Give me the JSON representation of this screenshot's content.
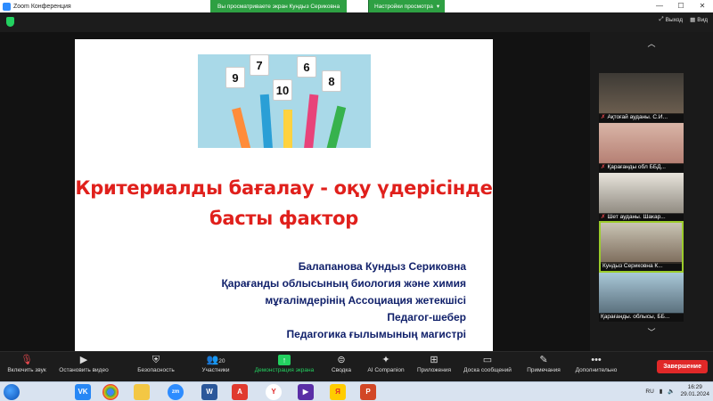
{
  "titlebar": {
    "app_title": "Zoom Конференция",
    "share_banner": "Вы просматриваете экран Кундыз Сериковна",
    "view_options": "Настройки просмотра",
    "view_options_caret": "▾"
  },
  "topbar": {
    "exit_label": "Выход",
    "view_label": "Вид"
  },
  "slide": {
    "cards": [
      "9",
      "7",
      "10",
      "6",
      "8"
    ],
    "title_line1": "Критериалды бағалау - оқу үдерісінде",
    "title_line2": "басты фактор",
    "author_lines": [
      "Балапанова Кундыз Сериковна",
      "Қарағанды облысының биология және химия",
      "мұғалімдерінің Ассоциация жетекшісі",
      "Педагог-шебер",
      "Педагогика ғылымының магистрі"
    ]
  },
  "gallery": {
    "up_chevron": "︿",
    "down_chevron": "﹀",
    "tiles": [
      {
        "name": "Ақтоғай ауданы. С.И...",
        "muted": true
      },
      {
        "name": "Қарағанды обл ББД...",
        "muted": true
      },
      {
        "name": "Шет ауданы. Шакар...",
        "muted": true
      },
      {
        "name": "Кундыз Сериковна К...",
        "muted": false
      },
      {
        "name": "Қарағанды. облысы, ББ...",
        "muted": false
      }
    ]
  },
  "toolbar": {
    "mute": "Включить звук",
    "video": "Остановить видео",
    "security": "Безопасность",
    "participants": "Участники",
    "participants_count": "20",
    "share": "Демонстрация экрана",
    "summary": "Сводка",
    "ai": "AI Companion",
    "apps": "Приложения",
    "chat": "Доска сообщений",
    "notes": "Примечания",
    "more": "Дополнительно",
    "end": "Завершение"
  },
  "taskbar": {
    "lang": "RU",
    "time": "16:29",
    "date": "29.01.2024",
    "apps": [
      "VK",
      "Chrome",
      "Explorer",
      "Zoom",
      "Word",
      "Acrobat",
      "Yandex",
      "Yandex",
      "PowerPoint"
    ]
  },
  "colors": {
    "accent_green": "#23d160",
    "title_red": "#e0201c",
    "author_navy": "#10206a",
    "end_red": "#e02828"
  }
}
